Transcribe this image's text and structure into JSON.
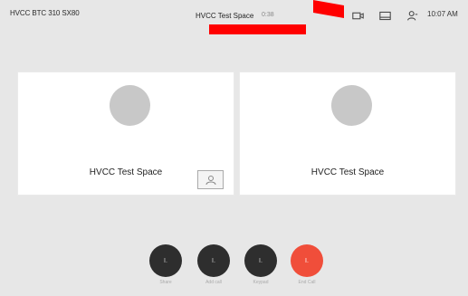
{
  "status_bar": {
    "device_name": "HVCC BTC 310 SX80",
    "call_title": "HVCC Test Space",
    "call_duration": "0:38",
    "clock": "10:07 AM",
    "icons": [
      "camera-icon",
      "layout-icon",
      "participants-icon"
    ]
  },
  "tiles": [
    {
      "name": "HVCC Test Space",
      "has_self_view": true
    },
    {
      "name": "HVCC Test Space",
      "has_self_view": false
    }
  ],
  "controls": [
    {
      "label": "Share",
      "glyph": "I.",
      "icon": "share-icon"
    },
    {
      "label": "Add call",
      "glyph": "I.",
      "icon": "add-call-icon"
    },
    {
      "label": "Keypad",
      "glyph": "I.",
      "icon": "keypad-icon"
    },
    {
      "label": "End Call",
      "glyph": "I.",
      "icon": "end-call-icon",
      "color": "#f04e3a"
    }
  ],
  "colors": {
    "background": "#e7e7e7",
    "tile": "#ffffff",
    "avatar": "#c8c8c8",
    "control": "#2e2e2e",
    "end_call": "#f04e3a",
    "redaction": "#ff0000"
  }
}
